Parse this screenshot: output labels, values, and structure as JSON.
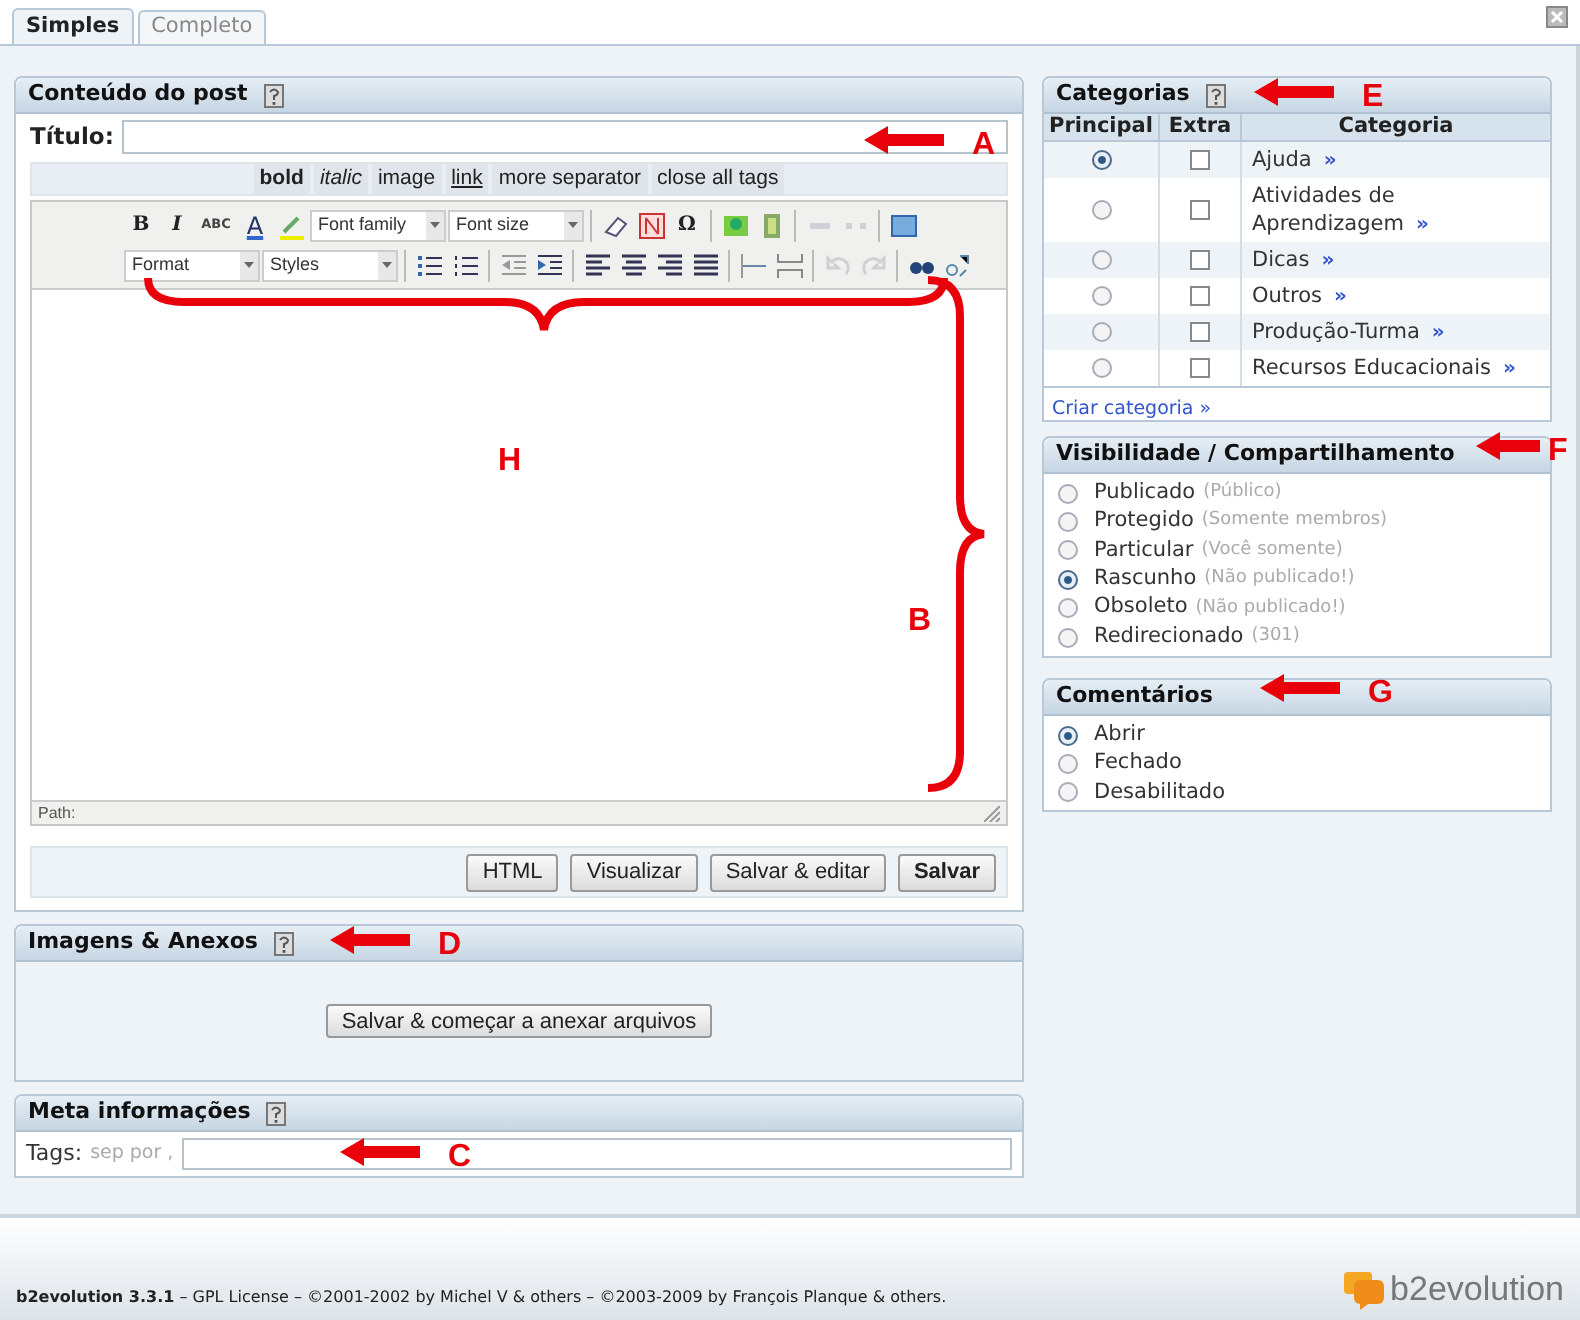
{
  "tabs": [
    {
      "label": "Simples",
      "selected": true
    },
    {
      "label": "Completo",
      "selected": false
    }
  ],
  "post_panel": {
    "title": "Conteúdo do post",
    "title_label": "Título:",
    "quicktags": [
      {
        "label": "bold",
        "kind": "bold"
      },
      {
        "label": "italic",
        "kind": "italic"
      },
      {
        "label": "image",
        "kind": "plain"
      },
      {
        "label": "link",
        "kind": "link"
      },
      {
        "label": "more separator",
        "kind": "plain"
      },
      {
        "label": "close all tags",
        "kind": "plain"
      }
    ],
    "toolbar_rows": [
      [
        {
          "kind": "glyph",
          "label": "B"
        },
        {
          "kind": "glyph",
          "label": "I"
        },
        {
          "kind": "glyph",
          "label": "ABC"
        },
        {
          "kind": "glyph",
          "label": "A"
        },
        {
          "kind": "icon",
          "disabled": false
        },
        {
          "kind": "select",
          "label": "Font family"
        },
        {
          "kind": "select",
          "label": "Font size"
        },
        {
          "kind": "sep"
        },
        {
          "kind": "icon",
          "disabled": false
        },
        {
          "kind": "icon",
          "disabled": false
        },
        {
          "kind": "glyph",
          "label": "Ω"
        },
        {
          "kind": "sep"
        },
        {
          "kind": "icon",
          "disabled": false
        },
        {
          "kind": "icon",
          "disabled": false
        },
        {
          "kind": "sep"
        },
        {
          "kind": "icon",
          "disabled": true
        },
        {
          "kind": "icon",
          "disabled": true
        },
        {
          "kind": "sep"
        },
        {
          "kind": "icon",
          "disabled": false
        }
      ],
      [
        {
          "kind": "select",
          "label": "Format"
        },
        {
          "kind": "select",
          "label": "Styles"
        },
        {
          "kind": "sep"
        },
        {
          "kind": "icon",
          "disabled": false
        },
        {
          "kind": "icon",
          "disabled": false
        },
        {
          "kind": "sep"
        },
        {
          "kind": "icon",
          "disabled": false
        },
        {
          "kind": "icon",
          "disabled": false
        },
        {
          "kind": "sep"
        },
        {
          "kind": "icon",
          "disabled": false
        },
        {
          "kind": "icon",
          "disabled": false
        },
        {
          "kind": "icon",
          "disabled": false
        },
        {
          "kind": "icon",
          "disabled": false
        },
        {
          "kind": "sep"
        },
        {
          "kind": "icon",
          "disabled": false
        },
        {
          "kind": "icon",
          "disabled": false
        },
        {
          "kind": "sep"
        },
        {
          "kind": "icon",
          "disabled": true
        },
        {
          "kind": "icon",
          "disabled": true
        },
        {
          "kind": "sep"
        },
        {
          "kind": "icon",
          "disabled": false
        },
        {
          "kind": "icon",
          "disabled": false
        }
      ]
    ],
    "path_label": "Path:",
    "buttons": [
      {
        "label": "HTML",
        "primary": false
      },
      {
        "label": "Visualizar",
        "primary": false
      },
      {
        "label": "Salvar & editar",
        "primary": false
      },
      {
        "label": "Salvar",
        "primary": true
      }
    ]
  },
  "attachments_panel": {
    "title": "Imagens & Anexos",
    "button": "Salvar & começar a anexar arquivos"
  },
  "meta_panel": {
    "title": "Meta informações",
    "tags_label": "Tags:",
    "tags_hint": "sep por ,"
  },
  "categories_panel": {
    "title": "Categorias",
    "columns": [
      "Principal",
      "Extra",
      "Categoria"
    ],
    "rows": [
      {
        "name": "Ajuda",
        "selected": true,
        "checked": false
      },
      {
        "name": "Atividades de Aprendizagem",
        "selected": false,
        "checked": false
      },
      {
        "name": "Dicas",
        "selected": false,
        "checked": false
      },
      {
        "name": "Outros",
        "selected": false,
        "checked": false
      },
      {
        "name": "Produção-Turma",
        "selected": false,
        "checked": false
      },
      {
        "name": "Recursos Educacionais",
        "selected": false,
        "checked": false
      }
    ],
    "row_link": "»",
    "create_link": "Criar categoria »"
  },
  "visibility_panel": {
    "title": "Visibilidade / Compartilhamento",
    "options": [
      {
        "label": "Publicado",
        "note": "(Público)",
        "selected": false
      },
      {
        "label": "Protegido",
        "note": "(Somente membros)",
        "selected": false
      },
      {
        "label": "Particular",
        "note": "(Você somente)",
        "selected": false
      },
      {
        "label": "Rascunho",
        "note": "(Não publicado!)",
        "selected": true
      },
      {
        "label": "Obsoleto",
        "note": "(Não publicado!)",
        "selected": false
      },
      {
        "label": "Redirecionado",
        "note": "(301)",
        "selected": false
      }
    ]
  },
  "comments_panel": {
    "title": "Comentários",
    "options": [
      {
        "label": "Abrir",
        "selected": true
      },
      {
        "label": "Fechado",
        "selected": false
      },
      {
        "label": "Desabilitado",
        "selected": false
      }
    ]
  },
  "footer": {
    "text": "**b2evolution 3.3.1** – GPL License – ©2001-2002 by Michel V & others – ©2003-2009 by François Planque & others.",
    "logo": "b2evolution"
  },
  "annotations": [
    {
      "label": "A",
      "kind": "arrow"
    },
    {
      "label": "E",
      "kind": "arrow"
    },
    {
      "label": "F",
      "kind": "arrow"
    },
    {
      "label": "G",
      "kind": "arrow"
    },
    {
      "label": "D",
      "kind": "arrow"
    },
    {
      "label": "C",
      "kind": "arrow"
    },
    {
      "label": "B",
      "kind": "vbrace"
    },
    {
      "label": "H",
      "kind": "hbrace"
    }
  ]
}
